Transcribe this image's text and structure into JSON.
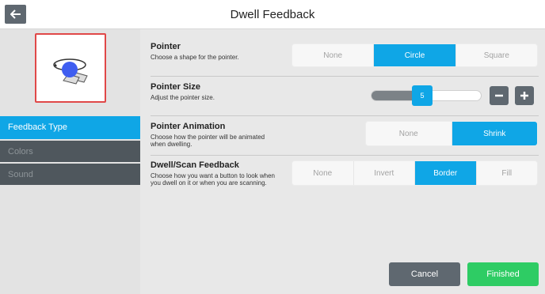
{
  "header": {
    "title": "Dwell Feedback",
    "back_icon": "arrow-left-icon"
  },
  "sidebar": {
    "preview_icon": "dwell-pointer-preview-icon",
    "items": [
      {
        "label": "Feedback Type",
        "active": true
      },
      {
        "label": "Colors",
        "active": false
      },
      {
        "label": "Sound",
        "active": false
      }
    ]
  },
  "settings": {
    "pointer": {
      "title": "Pointer",
      "description": "Choose a shape for the pointer.",
      "options": [
        "None",
        "Circle",
        "Square"
      ],
      "selected": "Circle"
    },
    "pointer_size": {
      "title": "Pointer Size",
      "description": "Adjust the pointer size.",
      "value": "5",
      "decrease_icon": "minus-icon",
      "increase_icon": "plus-icon"
    },
    "pointer_animation": {
      "title": "Pointer Animation",
      "description_line1": "Choose how the pointer will be animated",
      "description_line2": "when dwelling.",
      "options": [
        "None",
        "Shrink"
      ],
      "selected": "Shrink"
    },
    "dwell_scan_feedback": {
      "title": "Dwell/Scan Feedback",
      "description_line1": "Choose how you want a button to look when",
      "description_line2": "you dwell on it or when you are scanning.",
      "options": [
        "None",
        "Invert",
        "Border",
        "Fill"
      ],
      "selected": "Border"
    }
  },
  "footer": {
    "cancel_label": "Cancel",
    "finished_label": "Finished"
  },
  "colors": {
    "accent": "#0fa6e6",
    "dark": "#5f6870",
    "success": "#2ecc64",
    "preview_border": "#e04848"
  }
}
